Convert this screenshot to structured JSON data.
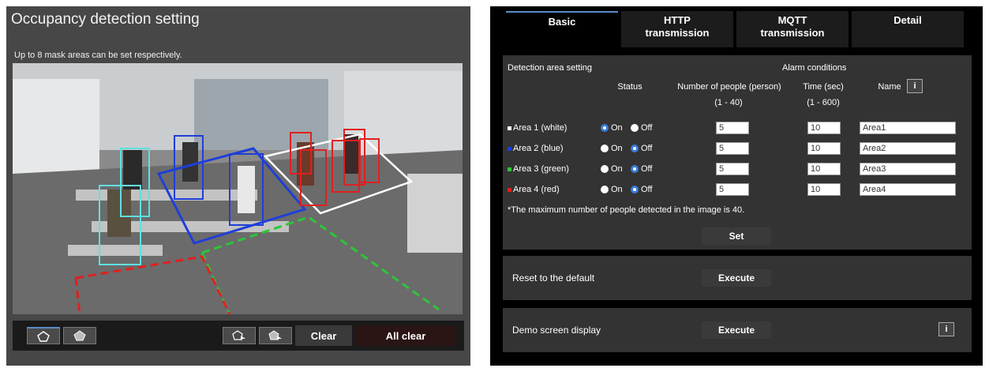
{
  "left_panel": {
    "title": "Occupancy detection setting",
    "subtitle": "Up to 8 mask areas can be set respectively.",
    "toolbar": {
      "clear_label": "Clear",
      "all_clear_label": "All clear"
    }
  },
  "tabs": [
    {
      "label": "Basic"
    },
    {
      "label": "HTTP transmission"
    },
    {
      "label": "MQTT transmission"
    },
    {
      "label": "Detail"
    }
  ],
  "detection": {
    "section_label": "Detection area setting",
    "alarm_label": "Alarm conditions",
    "status_header": "Status",
    "people_header": "Number of people (person)",
    "people_range": "(1 - 40)",
    "time_header": "Time (sec)",
    "time_range": "(1 - 600)",
    "name_header": "Name",
    "on_label": "On",
    "off_label": "Off",
    "areas": [
      {
        "label": "Area 1 (white)",
        "color": "#ffffff",
        "status": "On",
        "people": "5",
        "time": "10",
        "name": "Area1"
      },
      {
        "label": "Area 2 (blue)",
        "color": "#1f3fd8",
        "status": "Off",
        "people": "5",
        "time": "10",
        "name": "Area2"
      },
      {
        "label": "Area 3 (green)",
        "color": "#2fc43a",
        "status": "Off",
        "people": "5",
        "time": "10",
        "name": "Area3"
      },
      {
        "label": "Area 4 (red)",
        "color": "#e02020",
        "status": "Off",
        "people": "5",
        "time": "10",
        "name": "Area4"
      }
    ],
    "note": "*The maximum number of people detected in the image is 40.",
    "set_label": "Set"
  },
  "reset": {
    "label": "Reset to the default",
    "button": "Execute"
  },
  "demo": {
    "label": "Demo screen display",
    "button": "Execute"
  },
  "info_icon_text": "i"
}
